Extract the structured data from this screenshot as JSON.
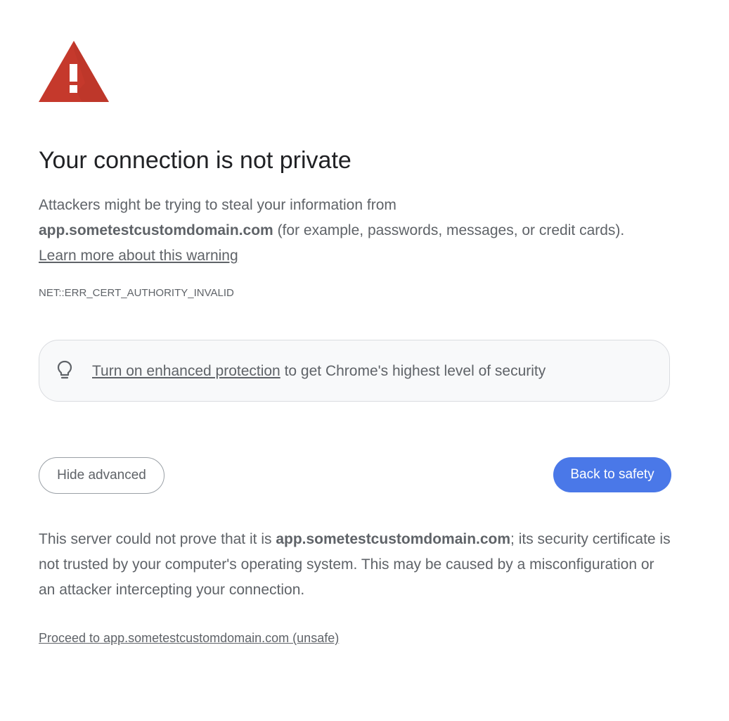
{
  "icons": {
    "warning": "warning-triangle-icon",
    "bulb": "lightbulb-icon"
  },
  "colors": {
    "warning_red": "#c5392c",
    "primary_button": "#4a78e8",
    "text": "#5f6368",
    "title": "#202124"
  },
  "title": "Your connection is not private",
  "main_message": {
    "intro": "Attackers might be trying to steal your information from",
    "domain": "app.sometestcustomdomain.com",
    "examples": " (for example, passwords, messages, or credit cards).",
    "learn_more": "Learn more about this warning"
  },
  "error_code": "NET::ERR_CERT_AUTHORITY_INVALID",
  "enhanced_protection": {
    "link": "Turn on enhanced protection",
    "text": " to get Chrome's highest level of security"
  },
  "buttons": {
    "hide_advanced": "Hide advanced",
    "back_to_safety": "Back to safety"
  },
  "details": {
    "part1": "This server could not prove that it is ",
    "domain": "app.sometestcustomdomain.com",
    "part2": "; its security certificate is not trusted by your computer's operating system. This may be caused by a misconfiguration or an attacker intercepting your connection."
  },
  "proceed_link": "Proceed to app.sometestcustomdomain.com (unsafe)"
}
